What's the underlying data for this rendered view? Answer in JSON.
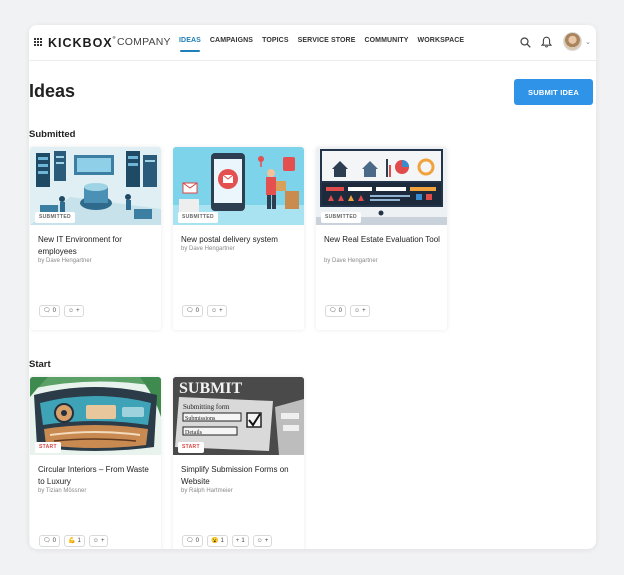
{
  "brand": {
    "name": "KICKBOX",
    "superscript": "®",
    "company": "COMPANY"
  },
  "nav": {
    "items": [
      "IDEAS",
      "CAMPAIGNS",
      "TOPICS",
      "SERVICE STORE",
      "COMMUNITY",
      "WORKSPACE"
    ],
    "active": "IDEAS"
  },
  "icons": {
    "apps": "grid-icon",
    "search": "search-icon",
    "notifications": "bell-icon",
    "account_menu": "chevron-down-icon"
  },
  "page": {
    "title": "Ideas",
    "submit_label": "SUBMIT IDEA"
  },
  "colors": {
    "accent": "#2f93e8",
    "active_nav": "#1f7fb8",
    "start_badge": "#d64545",
    "submitted_badge": "#666666"
  },
  "sections": [
    {
      "title": "Submitted",
      "cards": [
        {
          "title": "New IT Environment for employees",
          "author": "by Dave Hengartner",
          "badge": "SUBMITTED",
          "comments": "0",
          "add": "+"
        },
        {
          "title": "New postal delivery system",
          "author": "by Dave Hengartner",
          "badge": "SUBMITTED",
          "comments": "0",
          "add": "+"
        },
        {
          "title": "New Real Estate Evaluation Tool",
          "author": "by Dave Hengartner",
          "badge": "SUBMITTED",
          "comments": "0",
          "add": "+"
        }
      ]
    },
    {
      "title": "Start",
      "cards": [
        {
          "title": "Circular Interiors – From Waste to Luxury",
          "author": "by Tizian Mössner",
          "badge": "START",
          "comments": "0",
          "flex_count": "1",
          "add": "+"
        },
        {
          "title": "Simplify Submission Forms on Website",
          "author": "by Ralph Hartmeier",
          "badge": "START",
          "comments": "0",
          "wow_count": "1",
          "plus_count": "1",
          "add": "+"
        }
      ]
    }
  ],
  "image_text": {
    "submission_banner": "SUBMIT",
    "submission_lines": [
      "Submitting form",
      "Submissions",
      "Details"
    ]
  }
}
